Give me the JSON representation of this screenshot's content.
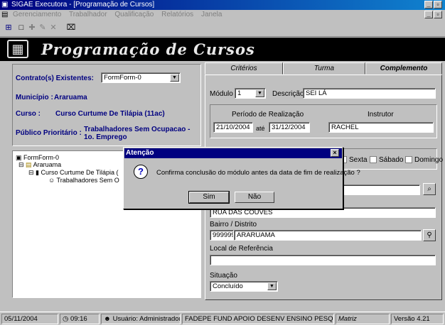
{
  "window": {
    "title": "SIGAE Executora - [Programação de Cursos]"
  },
  "menu": [
    "Gerenciamento",
    "Trabalhador",
    "Qualificação",
    "Relatórios",
    "Janela"
  ],
  "banner": {
    "title": "Programação de Cursos"
  },
  "left": {
    "contrato_label": "Contrato(s) Existentes:",
    "contrato_value": "FormForm-0",
    "municipio_label": "Município :",
    "municipio_value": "Araruama",
    "curso_label": "Curso :",
    "curso_value": "Curso Curtume De Tilápia (11ac)",
    "publico_label": "Público Prioritário :",
    "publico_value": "Trabalhadores Sem Ocupacao - 1o. Emprego"
  },
  "tree": [
    "FormForm-0",
    "Araruama",
    "Curso Curtume De Tilápia (",
    "Trabalhadores Sem O"
  ],
  "tabs": [
    "Critérios",
    "Turma",
    "Complemento"
  ],
  "form": {
    "modulo_label": "Módulo",
    "modulo_value": "1",
    "descricao_label": "Descrição",
    "descricao_value": "SEI LÁ",
    "periodo_label": "Período de Realização",
    "instrutor_label": "Instrutor",
    "data_inicio": "21/10/2004",
    "ate_label": "até",
    "data_fim": "31/12/2004",
    "instrutor_value": "RACHEL",
    "days": [
      "Sexta",
      "Sábado",
      "Domingo"
    ],
    "endereco_value": "RUA DAS COUVES",
    "bairro_label": "Bairro / Distrito",
    "bairro_code": "999999",
    "bairro_value": "ARARUAMA",
    "referencia_label": "Local de Referência",
    "referencia_value": "",
    "situacao_label": "Situação",
    "situacao_value": "Concluído"
  },
  "dialog": {
    "title": "Atenção",
    "message": "Confirma conclusão do módulo antes da data de fim de realização ?",
    "yes": "Sim",
    "no": "Não"
  },
  "status": {
    "date": "05/11/2004",
    "time": "09:16",
    "user": "Usuário: Administrador",
    "org": "FADEPE FUND APOIO DESENV ENSINO PESQ E E",
    "unit": "Matriz",
    "version": "Versão 4.21"
  },
  "colors": {
    "titlebar": "#000080",
    "label_navy": "#000080",
    "face": "#c0c0c0"
  }
}
